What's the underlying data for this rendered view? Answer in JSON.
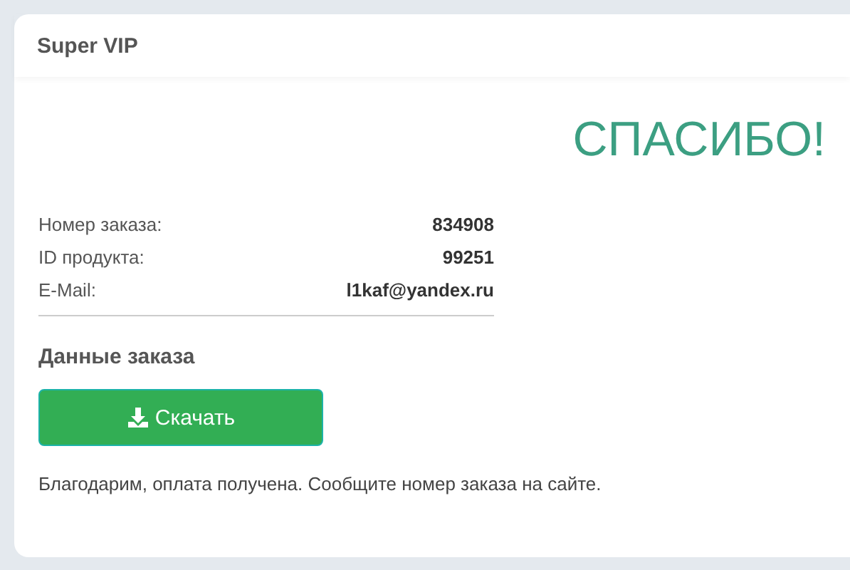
{
  "card": {
    "title": "Super VIP"
  },
  "thanks": "СПАСИБО!",
  "details": [
    {
      "label": "Номер заказа:",
      "value": "834908"
    },
    {
      "label": "ID продукта:",
      "value": "99251"
    },
    {
      "label": "E-Mail:",
      "value": "l1kaf@yandex.ru"
    }
  ],
  "section_title": "Данные заказа",
  "download_button": "Скачать",
  "note": "Благодарим, оплата получена. Сообщите номер заказа на сайте."
}
